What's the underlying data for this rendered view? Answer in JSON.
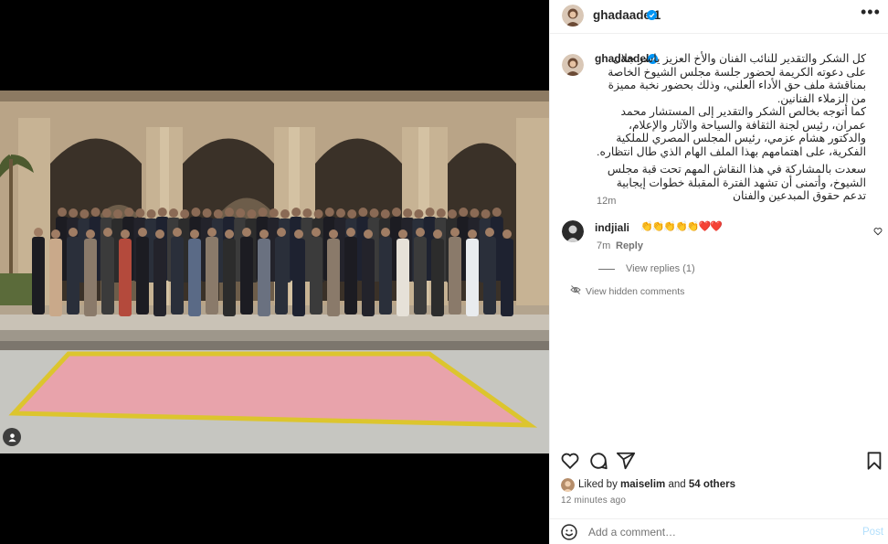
{
  "post": {
    "author": "ghadaadel1",
    "colors": {
      "verified": "#0095f6",
      "link_disabled": "#b2dffc",
      "muted": "#737373",
      "text": "#262626",
      "heart": "#ed4956"
    }
  },
  "caption": {
    "username": "ghadaadel1",
    "paragraph_1": "كل الشكر والتقدير للنائب الفنان والأخ العزيز ياسر جلال على دعوته الكريمة لحضور جلسة مجلس الشيوخ الخاصة بمناقشة ملف حق الأداء العلني، وذلك بحضور نخبة مميزة من الزملاء الفنانين.",
    "paragraph_2": "كما أتوجه بخالص الشكر والتقدير إلى المستشار محمد عمران، رئيس لجنة الثقافة والسياحة والآثار والإعلام، والدكتور هشام عزمي، رئيس المجلس المصري للملكية الفكرية، على اهتمامهم بهذا الملف الهام الذي طال انتظاره.",
    "paragraph_3": "سعدت بالمشاركة في هذا النقاش المهم تحت قبة مجلس الشيوخ، وأتمنى أن تشهد الفترة المقبلة خطوات إيجابية تدعم حقوق المبدعين والفنان",
    "time": "12m"
  },
  "comment": {
    "username": "indjiali",
    "text": "👏👏👏👏👏❤️❤️",
    "time": "7m",
    "reply_label": "Reply",
    "view_replies": "View replies (1)"
  },
  "hidden_comments_label": "View hidden comments",
  "actions": {
    "like_icon": "heart-icon",
    "comment_icon": "comment-icon",
    "share_icon": "share-icon",
    "save_icon": "bookmark-icon"
  },
  "likes": {
    "prefix": "Liked by ",
    "user": "maiselim",
    "middle": " and ",
    "others": "54 others"
  },
  "time_ago": "12 minutes ago",
  "add_comment": {
    "placeholder": "Add a comment…",
    "post_label": "Post",
    "emoji_icon": "emoji-icon"
  }
}
